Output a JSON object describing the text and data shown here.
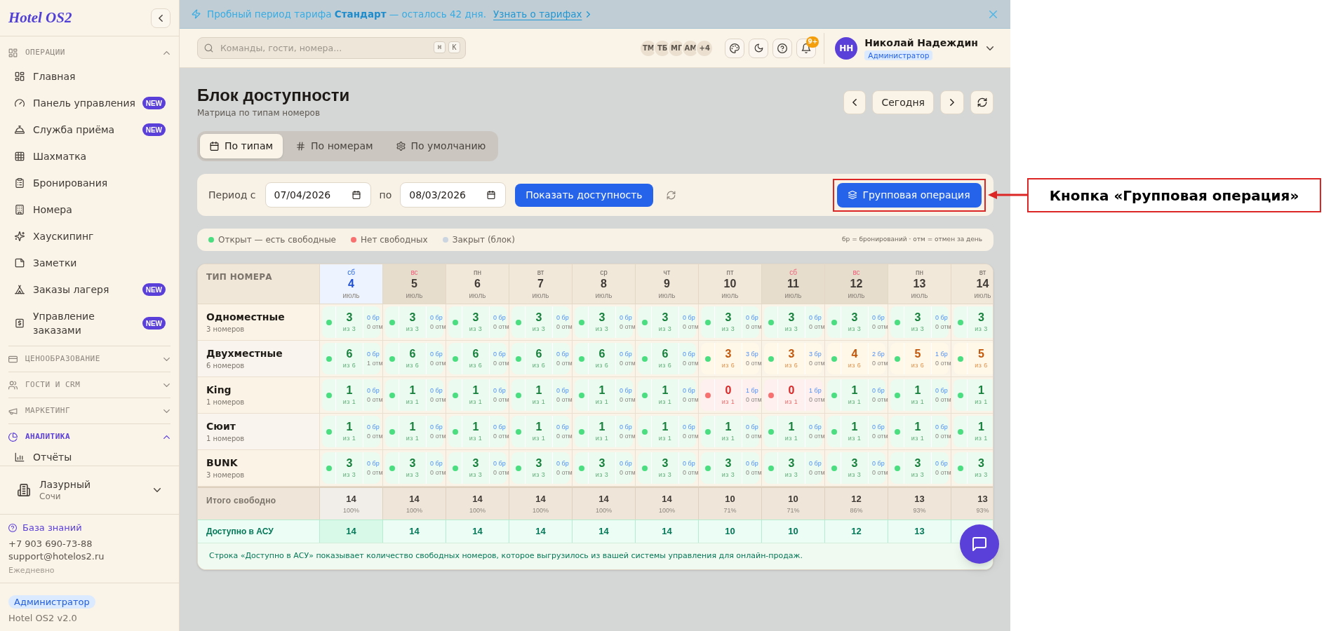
{
  "sidebar": {
    "logo": "Hotel OS2",
    "sections": [
      {
        "title": "ОПЕРАЦИИ",
        "expanded": true,
        "active": false,
        "items": [
          {
            "label": "Главная"
          },
          {
            "label": "Панель управления",
            "badge": "NEW"
          },
          {
            "label": "Служба приёма",
            "badge": "NEW"
          },
          {
            "label": "Шахматка"
          },
          {
            "label": "Бронирования"
          },
          {
            "label": "Номера"
          },
          {
            "label": "Хаускипинг"
          },
          {
            "label": "Заметки"
          },
          {
            "label": "Заказы лагеря",
            "badge": "NEW"
          },
          {
            "label": "Управление заказами",
            "badge": "NEW"
          }
        ]
      },
      {
        "title": "ЦЕНООБРАЗОВАНИЕ",
        "expanded": false,
        "active": false
      },
      {
        "title": "ГОСТИ И CRM",
        "expanded": false,
        "active": false
      },
      {
        "title": "МАРКЕТИНГ",
        "expanded": false,
        "active": false
      },
      {
        "title": "АНАЛИТИКА",
        "expanded": true,
        "active": true,
        "items": [
          {
            "label": "Отчёты"
          }
        ]
      }
    ],
    "hotel": {
      "name": "Лазурный",
      "city": "Сочи"
    },
    "support": {
      "link": "База знаний",
      "phone": "+7 903 690-73-88",
      "email": "support@hotelos2.ru",
      "hours": "Ежедневно"
    },
    "role": "Администратор",
    "version": "Hotel OS2 v2.0"
  },
  "banner": {
    "text": "Пробный период тарифа **Стандарт** — осталось 42 дня.",
    "link": "Узнать о тарифах"
  },
  "top_bar": {
    "search": {
      "placeholder": "Команды, гости, номера...",
      "keys": [
        "⌘",
        "K"
      ]
    },
    "online_users": [
      "ТМ",
      "ТБ",
      "МГ",
      "АМ",
      "+4"
    ],
    "notifications_badge": "9+",
    "user": {
      "initials": "НН",
      "name": "Николай Надеждин",
      "role": "Администратор"
    }
  },
  "page": {
    "title": "Блок доступности",
    "subtitle": "Матрица по типам номеров",
    "today_button": "Сегодня"
  },
  "tabs": [
    {
      "label": "По типам",
      "selected": true
    },
    {
      "label": "По номерам",
      "selected": false
    },
    {
      "label": "По умолчанию",
      "selected": false
    }
  ],
  "filter": {
    "from_label": "Период с",
    "from": "07/04/2026",
    "to_label": "по",
    "to": "08/03/2026",
    "submit": "Показать доступность",
    "bulk_action": "Групповая операция"
  },
  "legend": {
    "items": [
      {
        "label": "Открыт — есть свободные",
        "color": "#4ade80"
      },
      {
        "label": "Нет свободных",
        "color": "#f87171"
      },
      {
        "label": "Закрыт (блок)",
        "color": "#cbd5e1"
      }
    ],
    "note": "бр = бронирований · отм = отмен за день"
  },
  "table": {
    "corner": "ТИП НОМЕРА",
    "days": [
      {
        "weekday": "сб",
        "day": "4",
        "month": "июль",
        "today": true
      },
      {
        "weekday": "вс",
        "day": "5",
        "month": "июль",
        "today": false,
        "weekend": true
      },
      {
        "weekday": "пн",
        "day": "6",
        "month": "июль",
        "today": false,
        "weekend": false
      },
      {
        "weekday": "вт",
        "day": "7",
        "month": "июль",
        "today": false,
        "weekend": false
      },
      {
        "weekday": "ср",
        "day": "8",
        "month": "июль",
        "today": false,
        "weekend": false
      },
      {
        "weekday": "чт",
        "day": "9",
        "month": "июль",
        "today": false,
        "weekend": false
      },
      {
        "weekday": "пт",
        "day": "10",
        "month": "июль",
        "today": false,
        "weekend": false
      },
      {
        "weekday": "сб",
        "day": "11",
        "month": "июль",
        "today": false,
        "weekend": true
      },
      {
        "weekday": "вс",
        "day": "12",
        "month": "июль",
        "today": false,
        "weekend": true
      },
      {
        "weekday": "пн",
        "day": "13",
        "month": "июль",
        "today": false,
        "weekend": false
      },
      {
        "weekday": "вт",
        "day": "14",
        "month": "июль",
        "today": false,
        "weekend": false
      }
    ],
    "rows": [
      {
        "name": "Одноместные",
        "count": "3 номеров",
        "cells": [
          {
            "kind": "free",
            "color": "#4ade80",
            "value": "3",
            "of": "из 3",
            "booked": "0 бр",
            "cancelled": "0 отм"
          },
          {
            "kind": "free",
            "color": "#4ade80",
            "value": "3",
            "of": "из 3",
            "booked": "0 бр",
            "cancelled": "0 отм"
          },
          {
            "kind": "free",
            "color": "#4ade80",
            "value": "3",
            "of": "из 3",
            "booked": "0 бр",
            "cancelled": "0 отм"
          },
          {
            "kind": "free",
            "color": "#4ade80",
            "value": "3",
            "of": "из 3",
            "booked": "0 бр",
            "cancelled": "0 отм"
          },
          {
            "kind": "free",
            "color": "#4ade80",
            "value": "3",
            "of": "из 3",
            "booked": "0 бр",
            "cancelled": "0 отм"
          },
          {
            "kind": "free",
            "color": "#4ade80",
            "value": "3",
            "of": "из 3",
            "booked": "0 бр",
            "cancelled": "0 отм"
          },
          {
            "kind": "free",
            "color": "#4ade80",
            "value": "3",
            "of": "из 3",
            "booked": "0 бр",
            "cancelled": "0 отм"
          },
          {
            "kind": "free",
            "color": "#4ade80",
            "value": "3",
            "of": "из 3",
            "booked": "0 бр",
            "cancelled": "0 отм"
          },
          {
            "kind": "free",
            "color": "#4ade80",
            "value": "3",
            "of": "из 3",
            "booked": "0 бр",
            "cancelled": "0 отм"
          },
          {
            "kind": "free",
            "color": "#4ade80",
            "value": "3",
            "of": "из 3",
            "booked": "0 бр",
            "cancelled": "0 отм"
          },
          {
            "kind": "free",
            "color": "#4ade80",
            "value": "3",
            "of": "из 3"
          }
        ]
      },
      {
        "name": "Двухместные",
        "count": "6 номеров",
        "cells": [
          {
            "kind": "free",
            "color": "#4ade80",
            "value": "6",
            "of": "из 6",
            "booked": "0 бр",
            "cancelled": "1 отм"
          },
          {
            "kind": "free",
            "color": "#4ade80",
            "value": "6",
            "of": "из 6",
            "booked": "0 бр",
            "cancelled": "0 отм"
          },
          {
            "kind": "free",
            "color": "#4ade80",
            "value": "6",
            "of": "из 6",
            "booked": "0 бр",
            "cancelled": "0 отм"
          },
          {
            "kind": "free",
            "color": "#4ade80",
            "value": "6",
            "of": "из 6",
            "booked": "0 бр",
            "cancelled": "0 отм"
          },
          {
            "kind": "free",
            "color": "#4ade80",
            "value": "6",
            "of": "из 6",
            "booked": "0 бр",
            "cancelled": "0 отм"
          },
          {
            "kind": "free",
            "color": "#4ade80",
            "value": "6",
            "of": "из 6",
            "booked": "0 бр",
            "cancelled": "0 отм"
          },
          {
            "kind": "partial",
            "color": "#4ade80",
            "value": "3",
            "of": "из 6",
            "booked": "3 бр",
            "cancelled": "0 отм"
          },
          {
            "kind": "partial",
            "color": "#4ade80",
            "value": "3",
            "of": "из 6",
            "booked": "3 бр",
            "cancelled": "0 отм"
          },
          {
            "kind": "partial",
            "color": "#4ade80",
            "value": "4",
            "of": "из 6",
            "booked": "2 бр",
            "cancelled": "0 отм"
          },
          {
            "kind": "partial",
            "color": "#4ade80",
            "value": "5",
            "of": "из 6",
            "booked": "1 бр",
            "cancelled": "0 отм"
          },
          {
            "kind": "partial",
            "color": "#4ade80",
            "value": "5",
            "of": "из 6"
          }
        ]
      },
      {
        "name": "King",
        "count": "1 номеров",
        "cells": [
          {
            "kind": "free",
            "color": "#4ade80",
            "value": "1",
            "of": "из 1",
            "booked": "0 бр",
            "cancelled": "0 отм"
          },
          {
            "kind": "free",
            "color": "#4ade80",
            "value": "1",
            "of": "из 1",
            "booked": "0 бр",
            "cancelled": "0 отм"
          },
          {
            "kind": "free",
            "color": "#4ade80",
            "value": "1",
            "of": "из 1",
            "booked": "0 бр",
            "cancelled": "0 отм"
          },
          {
            "kind": "free",
            "color": "#4ade80",
            "value": "1",
            "of": "из 1",
            "booked": "0 бр",
            "cancelled": "0 отм"
          },
          {
            "kind": "free",
            "color": "#4ade80",
            "value": "1",
            "of": "из 1",
            "booked": "0 бр",
            "cancelled": "0 отм"
          },
          {
            "kind": "free",
            "color": "#4ade80",
            "value": "1",
            "of": "из 1",
            "booked": "0 бр",
            "cancelled": "0 отм"
          },
          {
            "kind": "none",
            "color": "#f87171",
            "value": "0",
            "of": "из 1",
            "booked": "1 бр",
            "cancelled": "0 отм"
          },
          {
            "kind": "none",
            "color": "#f87171",
            "value": "0",
            "of": "из 1",
            "booked": "1 бр",
            "cancelled": "0 отм"
          },
          {
            "kind": "free",
            "color": "#4ade80",
            "value": "1",
            "of": "из 1",
            "booked": "0 бр",
            "cancelled": "0 отм"
          },
          {
            "kind": "free",
            "color": "#4ade80",
            "value": "1",
            "of": "из 1",
            "booked": "0 бр",
            "cancelled": "0 отм"
          },
          {
            "kind": "free",
            "color": "#4ade80",
            "value": "1",
            "of": "из 1"
          }
        ]
      },
      {
        "name": "Сюит",
        "count": "1 номеров",
        "cells": [
          {
            "kind": "free",
            "color": "#4ade80",
            "value": "1",
            "of": "из 1",
            "booked": "0 бр",
            "cancelled": "0 отм"
          },
          {
            "kind": "free",
            "color": "#4ade80",
            "value": "1",
            "of": "из 1",
            "booked": "0 бр",
            "cancelled": "0 отм"
          },
          {
            "kind": "free",
            "color": "#4ade80",
            "value": "1",
            "of": "из 1",
            "booked": "0 бр",
            "cancelled": "0 отм"
          },
          {
            "kind": "free",
            "color": "#4ade80",
            "value": "1",
            "of": "из 1",
            "booked": "0 бр",
            "cancelled": "0 отм"
          },
          {
            "kind": "free",
            "color": "#4ade80",
            "value": "1",
            "of": "из 1",
            "booked": "0 бр",
            "cancelled": "0 отм"
          },
          {
            "kind": "free",
            "color": "#4ade80",
            "value": "1",
            "of": "из 1",
            "booked": "0 бр",
            "cancelled": "0 отм"
          },
          {
            "kind": "free",
            "color": "#4ade80",
            "value": "1",
            "of": "из 1",
            "booked": "0 бр",
            "cancelled": "0 отм"
          },
          {
            "kind": "free",
            "color": "#4ade80",
            "value": "1",
            "of": "из 1",
            "booked": "0 бр",
            "cancelled": "0 отм"
          },
          {
            "kind": "free",
            "color": "#4ade80",
            "value": "1",
            "of": "из 1",
            "booked": "0 бр",
            "cancelled": "0 отм"
          },
          {
            "kind": "free",
            "color": "#4ade80",
            "value": "1",
            "of": "из 1",
            "booked": "0 бр",
            "cancelled": "0 отм"
          },
          {
            "kind": "free",
            "color": "#4ade80",
            "value": "1",
            "of": "из 1"
          }
        ]
      },
      {
        "name": "BUNK",
        "count": "3 номеров",
        "cells": [
          {
            "kind": "free",
            "color": "#4ade80",
            "value": "3",
            "of": "из 3",
            "booked": "0 бр",
            "cancelled": "0 отм"
          },
          {
            "kind": "free",
            "color": "#4ade80",
            "value": "3",
            "of": "из 3",
            "booked": "0 бр",
            "cancelled": "0 отм"
          },
          {
            "kind": "free",
            "color": "#4ade80",
            "value": "3",
            "of": "из 3",
            "booked": "0 бр",
            "cancelled": "0 отм"
          },
          {
            "kind": "free",
            "color": "#4ade80",
            "value": "3",
            "of": "из 3",
            "booked": "0 бр",
            "cancelled": "0 отм"
          },
          {
            "kind": "free",
            "color": "#4ade80",
            "value": "3",
            "of": "из 3",
            "booked": "0 бр",
            "cancelled": "0 отм"
          },
          {
            "kind": "free",
            "color": "#4ade80",
            "value": "3",
            "of": "из 3",
            "booked": "0 бр",
            "cancelled": "0 отм"
          },
          {
            "kind": "free",
            "color": "#4ade80",
            "value": "3",
            "of": "из 3",
            "booked": "0 бр",
            "cancelled": "0 отм"
          },
          {
            "kind": "free",
            "color": "#4ade80",
            "value": "3",
            "of": "из 3",
            "booked": "0 бр",
            "cancelled": "0 отм"
          },
          {
            "kind": "free",
            "color": "#4ade80",
            "value": "3",
            "of": "из 3",
            "booked": "0 бр",
            "cancelled": "0 отм"
          },
          {
            "kind": "free",
            "color": "#4ade80",
            "value": "3",
            "of": "из 3",
            "booked": "0 бр",
            "cancelled": "0 отм"
          },
          {
            "kind": "free",
            "color": "#4ade80",
            "value": "3",
            "of": "из 3"
          }
        ]
      }
    ],
    "total": {
      "label": "Итого свободно",
      "cells": [
        {
          "value": "14",
          "share": "100%"
        },
        {
          "value": "14",
          "share": "100%"
        },
        {
          "value": "14",
          "share": "100%"
        },
        {
          "value": "14",
          "share": "100%"
        },
        {
          "value": "14",
          "share": "100%"
        },
        {
          "value": "14",
          "share": "100%"
        },
        {
          "value": "10",
          "share": "71%"
        },
        {
          "value": "10",
          "share": "71%"
        },
        {
          "value": "12",
          "share": "86%"
        },
        {
          "value": "13",
          "share": "93%"
        },
        {
          "value": "13",
          "share": "93%"
        }
      ]
    },
    "asu": {
      "label": "Доступно в АСУ",
      "values": [
        "14",
        "14",
        "14",
        "14",
        "14",
        "14",
        "10",
        "10",
        "12",
        "13"
      ]
    },
    "note": "Строка «Доступно в АСУ» показывает количество свободных номеров, которое выгрузилось из вашей системы управления для онлайн-продаж."
  },
  "callout": {
    "text": "Кнопка «Групповая операция»"
  }
}
